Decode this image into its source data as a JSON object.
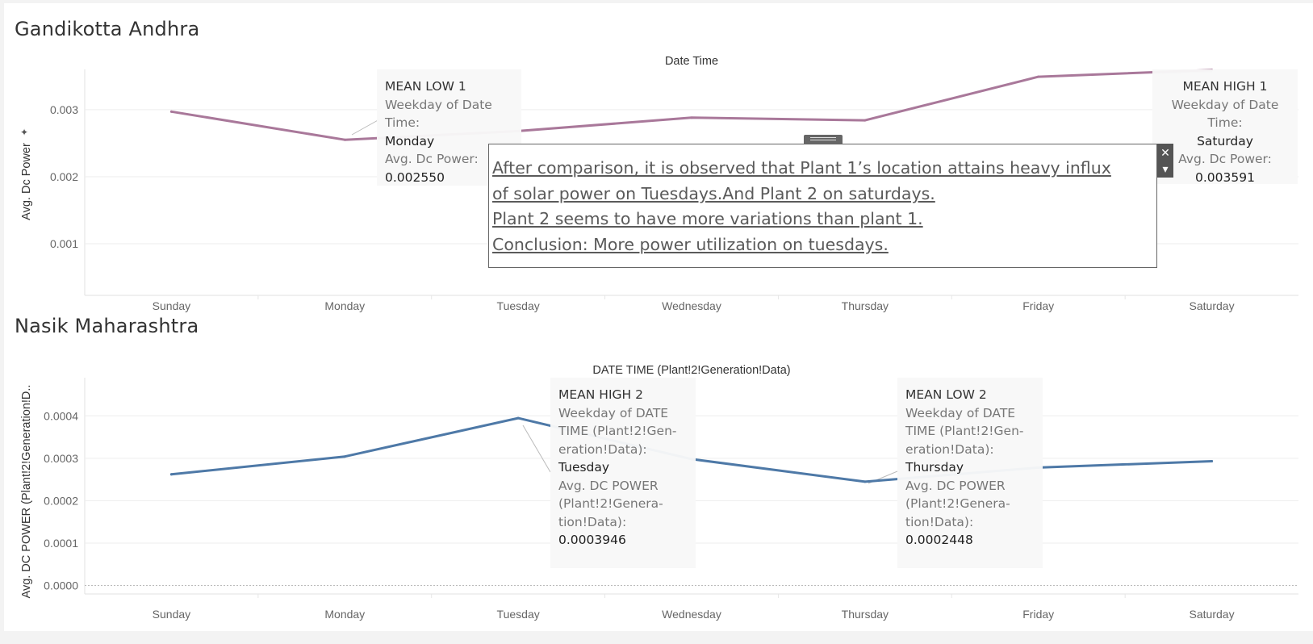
{
  "dashboard": {
    "sheets": [
      {
        "title": "Gandikotta Andhra",
        "header": "Date Time",
        "y_axis_label": "Avg. Dc Power",
        "line_color": "#a9789a",
        "y_ticks": [
          "0.003",
          "0.002",
          "0.001"
        ],
        "x_ticks": [
          "Sunday",
          "Monday",
          "Tuesday",
          "Wednesday",
          "Thursday",
          "Friday",
          "Saturday"
        ],
        "annotations": [
          {
            "title": "MEAN LOW 1",
            "dim_label": "Weekday of Date Time:",
            "dim_value": "Monday",
            "measure_label": "Avg. Dc Power:",
            "measure_value": "0.002550"
          },
          {
            "title": "MEAN HIGH 1",
            "dim_label": "Weekday of Date Time:",
            "dim_value": "Saturday",
            "measure_label": "Avg. Dc Power:",
            "measure_value": "0.003591"
          }
        ]
      },
      {
        "title": "Nasik Maharashtra",
        "header": "DATE TIME (Plant!2!Generation!Data)",
        "y_axis_label": "Avg. DC POWER (Plant!2!Generation!D..",
        "line_color": "#4e79a7",
        "y_ticks": [
          "0.0004",
          "0.0003",
          "0.0002",
          "0.0001",
          "0.0000"
        ],
        "x_ticks": [
          "Sunday",
          "Monday",
          "Tuesday",
          "Wednesday",
          "Thursday",
          "Friday",
          "Saturday"
        ],
        "annotations": [
          {
            "title": "MEAN HIGH 2",
            "dim_label": "Weekday of DATE TIME (Plant!2!Gen-eration!Data):",
            "dim_value": "Tuesday",
            "measure_label": "Avg. DC POWER (Plant!2!Genera-tion!Data):",
            "measure_value": "0.0003946"
          },
          {
            "title": "MEAN LOW 2",
            "dim_label": "Weekday of DATE TIME (Plant!2!Gen-eration!Data):",
            "dim_value": "Thursday",
            "measure_label": "Avg. DC POWER (Plant!2!Genera-tion!Data):",
            "measure_value": "0.0002448"
          }
        ]
      }
    ],
    "text_box": {
      "lines": [
        "After comparison, it is observed that Plant 1’s location attains heavy influx",
        "of solar power on Tuesdays.And Plant 2 on saturdays.",
        "Plant 2 seems to have more variations than plant 1.",
        "Conclusion: More power utilization on tuesdays."
      ]
    },
    "controls": {
      "close_glyph": "✕",
      "menu_glyph": "▾",
      "pin_glyph": "✦"
    }
  },
  "chart_data": [
    {
      "type": "line",
      "title": "Gandikotta Andhra",
      "xlabel": "Date Time",
      "ylabel": "Avg. Dc Power",
      "categories": [
        "Sunday",
        "Monday",
        "Tuesday",
        "Wednesday",
        "Thursday",
        "Friday",
        "Saturday"
      ],
      "values": [
        0.00297,
        0.00255,
        0.00268,
        0.00288,
        0.00284,
        0.00349,
        0.003591
      ],
      "ylim": [
        0.00023,
        0.0036
      ],
      "grid": true,
      "color": "#a9789a"
    },
    {
      "type": "line",
      "title": "Nasik Maharashtra",
      "xlabel": "DATE TIME (Plant!2!Generation!Data)",
      "ylabel": "Avg. DC POWER (Plant!2!Generation!D..",
      "categories": [
        "Sunday",
        "Monday",
        "Tuesday",
        "Wednesday",
        "Thursday",
        "Friday",
        "Saturday"
      ],
      "values": [
        0.000262,
        0.000304,
        0.0003946,
        0.000298,
        0.0002448,
        0.000278,
        0.000293
      ],
      "ylim": [
        -2e-05,
        0.00049
      ],
      "grid": true,
      "color": "#4e79a7"
    }
  ]
}
